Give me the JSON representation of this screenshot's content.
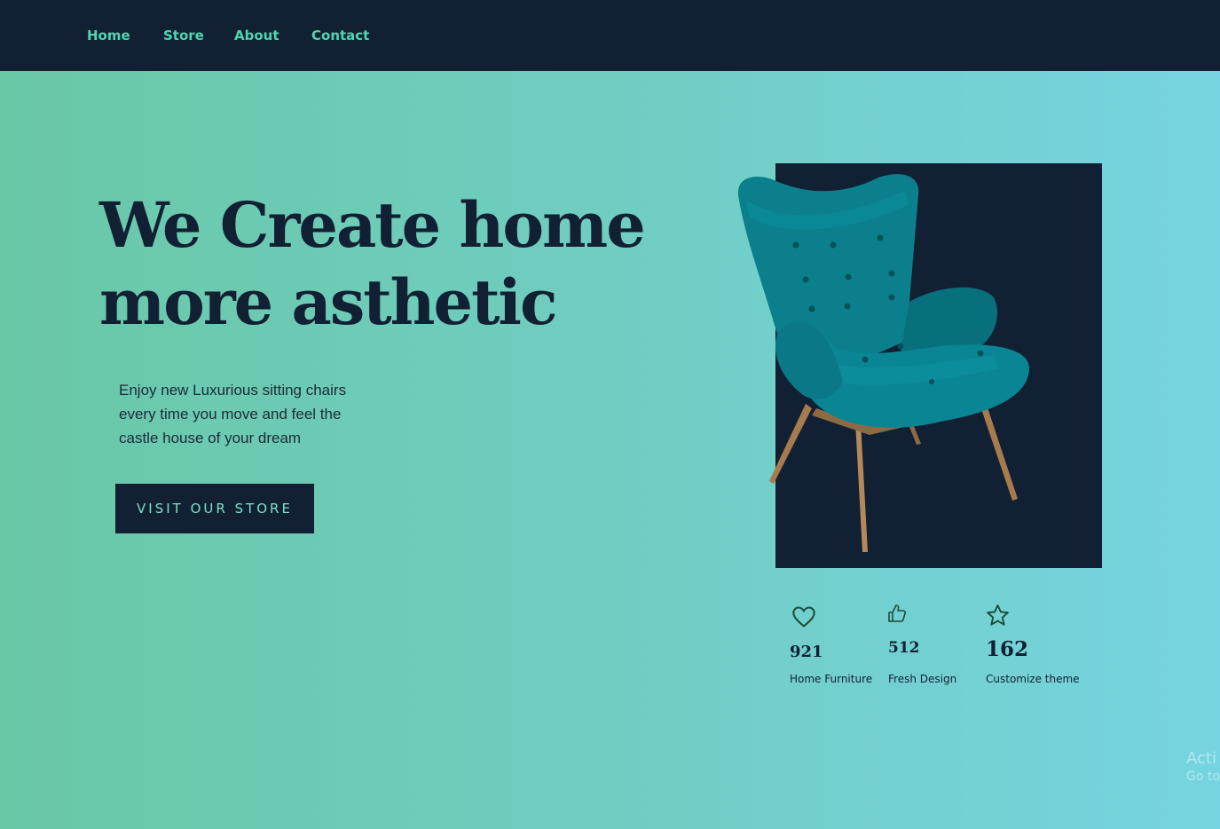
{
  "nav": {
    "items": [
      {
        "label": "Home"
      },
      {
        "label": "Store"
      },
      {
        "label": "About"
      },
      {
        "label": "Contact"
      }
    ]
  },
  "hero": {
    "title_line1": "We Create home",
    "title_line2": "more asthetic",
    "subtitle_line1": "Enjoy new Luxurious sitting chairs",
    "subtitle_line2": "every time you move and feel the",
    "subtitle_line3": "castle house of your dream",
    "cta_label": "VISIT OUR STORE"
  },
  "stats": [
    {
      "icon": "heart-icon",
      "value": "921",
      "label": "Home Furniture"
    },
    {
      "icon": "thumbs-up-icon",
      "value": "512",
      "label": "Fresh Design"
    },
    {
      "icon": "star-icon",
      "value": "162",
      "label": "Customize theme"
    }
  ],
  "watermark": {
    "line1": "Acti",
    "line2": "Go to"
  },
  "colors": {
    "nav_bg": "#122033",
    "nav_link": "#4fd4b0",
    "accent_dark": "#122033",
    "chair": "#087d8a",
    "gradient_start": "#69c8a6",
    "gradient_end": "#76d4e0"
  }
}
